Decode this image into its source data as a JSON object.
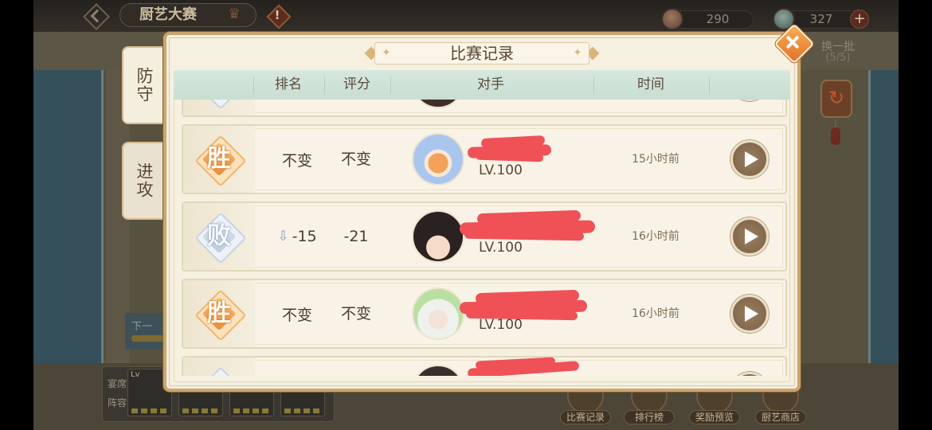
{
  "background": {
    "header": {
      "title": "厨艺大赛"
    },
    "currency": [
      {
        "icon": "coin-icon",
        "amount": "290"
      },
      {
        "icon": "gem-icon",
        "amount": "327"
      }
    ],
    "refresh": {
      "label": "换一批",
      "count": "(5/5)",
      "icon": "refresh-icon"
    },
    "side_button": {
      "label": "下一"
    },
    "lineup": {
      "label": "宴席阵容",
      "card_badge": "Lv"
    },
    "bottom_nav": [
      {
        "label": "比赛记录",
        "icon": "vs-icon"
      },
      {
        "label": "排行榜",
        "icon": "leaderboard-icon"
      },
      {
        "label": "奖励预览",
        "icon": "reward-preview-icon"
      },
      {
        "label": "厨艺商店",
        "icon": "shop-icon"
      }
    ]
  },
  "dialog": {
    "title": "比赛记录",
    "tabs": [
      {
        "label": "防守",
        "selected": true
      },
      {
        "label": "进攻",
        "selected": false
      }
    ],
    "columns": {
      "rank": "排名",
      "score": "评分",
      "opponent": "对手",
      "time": "时间"
    },
    "rows": [
      {
        "won": false
      },
      {
        "won": true,
        "result": "胜",
        "rank_change": "不变",
        "rank_down": false,
        "score_change": "不变",
        "level": "LV.100",
        "time": "15小时前"
      },
      {
        "won": false,
        "result": "败",
        "rank_change": "-15",
        "rank_down": true,
        "score_change": "-21",
        "level": "LV.100",
        "time": "16小时前"
      },
      {
        "won": true,
        "result": "胜",
        "rank_change": "不变",
        "rank_down": false,
        "score_change": "不变",
        "level": "LV.100",
        "time": "16小时前"
      },
      {
        "won": false
      }
    ]
  },
  "colors": {
    "win_badge": "#eb8a3a",
    "lose_badge": "#bccbdd",
    "header_band": "#cfe2d6",
    "panel": "#f6f0e0",
    "frame": "#caa56d",
    "close_button": "#e57a2b",
    "redaction": "#ef5157"
  }
}
